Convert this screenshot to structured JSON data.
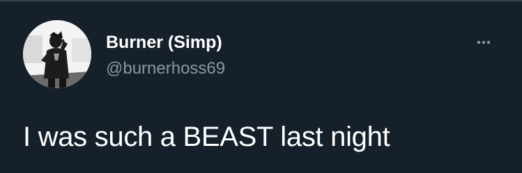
{
  "tweet": {
    "author": {
      "display_name": "Burner (Simp)",
      "handle": "@burnerhoss69",
      "avatar_icon": "profile-photo-performer-with-microphone"
    },
    "text": "I was such a BEAST last night",
    "more_icon": "more-options-ellipsis-icon"
  },
  "colors": {
    "background": "#15202b",
    "divider": "#38444d",
    "primary_text": "#ffffff",
    "secondary_text": "#8899a6"
  }
}
